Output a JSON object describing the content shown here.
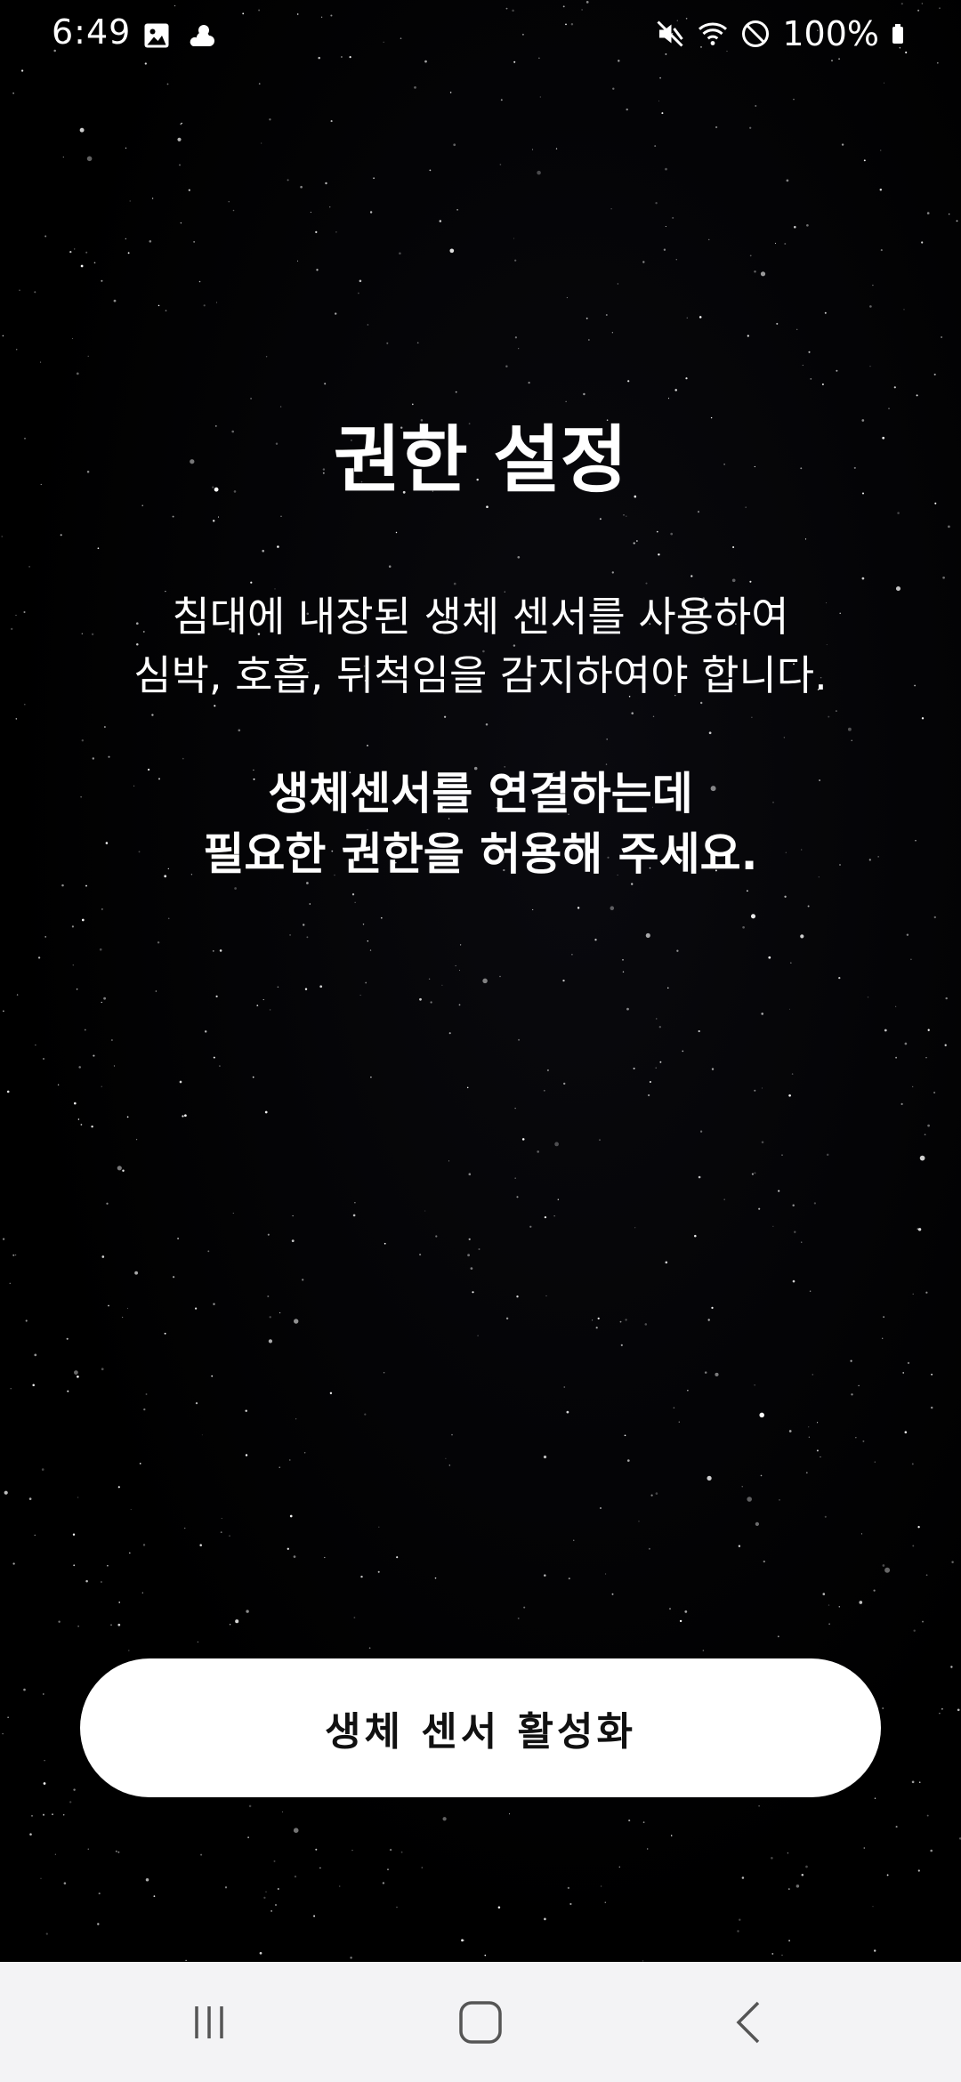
{
  "status_bar": {
    "time": "6:49",
    "battery": "100%",
    "left_icons": [
      "gallery-icon",
      "weather-icon"
    ],
    "right_icons": [
      "mute-icon",
      "wifi-icon",
      "do-not-disturb-icon",
      "battery-icon"
    ]
  },
  "main": {
    "title": "권한 설정",
    "description_lines": [
      "침대에 내장된 생체 센서를 사용하여",
      "심박, 호흡, 뒤척임을 감지하여야 합니다."
    ],
    "emphasis_lines": [
      "생체센서를 연결하는데",
      "필요한 권한을 허용해 주세요."
    ],
    "button_label": "생체 센서 활성화"
  },
  "nav_bar": {
    "items": [
      "recents-icon",
      "home-icon",
      "back-icon"
    ]
  },
  "colors": {
    "background": "#000000",
    "text": "#ffffff",
    "button_bg": "#ffffff",
    "button_text": "#111111",
    "nav_bg": "#f3f3f5"
  }
}
